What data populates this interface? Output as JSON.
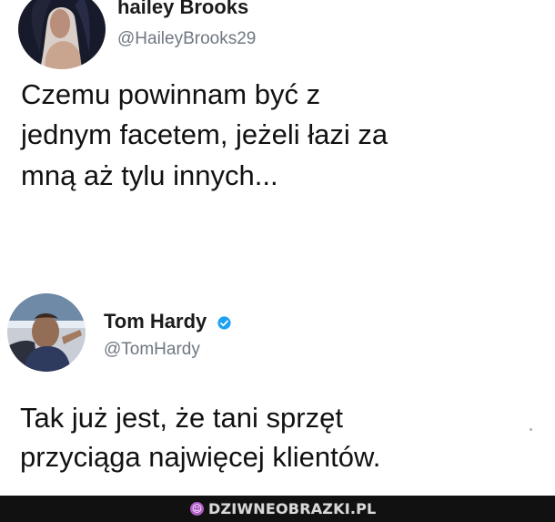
{
  "tweets": [
    {
      "display_name": "hailey Brooks",
      "handle": "@HaileyBrooks29",
      "text_lines": [
        "Czemu powinnam być z",
        "jednym facetem, jeżeli łazi za",
        "mną aż tylu innych..."
      ],
      "verified": false,
      "avatar_icon": "user-avatar-photo"
    },
    {
      "display_name": "Tom Hardy",
      "handle": "@TomHardy",
      "text_lines": [
        "Tak już jest, że tani sprzęt",
        "przyciąga najwięcej klientów."
      ],
      "verified": true,
      "verified_icon": "verified-badge-icon",
      "avatar_icon": "user-avatar-photo"
    }
  ],
  "footer": {
    "site_name": "DZIWNEOBRAZKI.PL",
    "icon": "site-logo-icon",
    "colors": {
      "bar": "#111111",
      "icon": "#b15ec8",
      "text": "#d9d9d9"
    }
  },
  "colors": {
    "verified_blue": "#1da1f2",
    "handle_gray": "#6f7780"
  }
}
